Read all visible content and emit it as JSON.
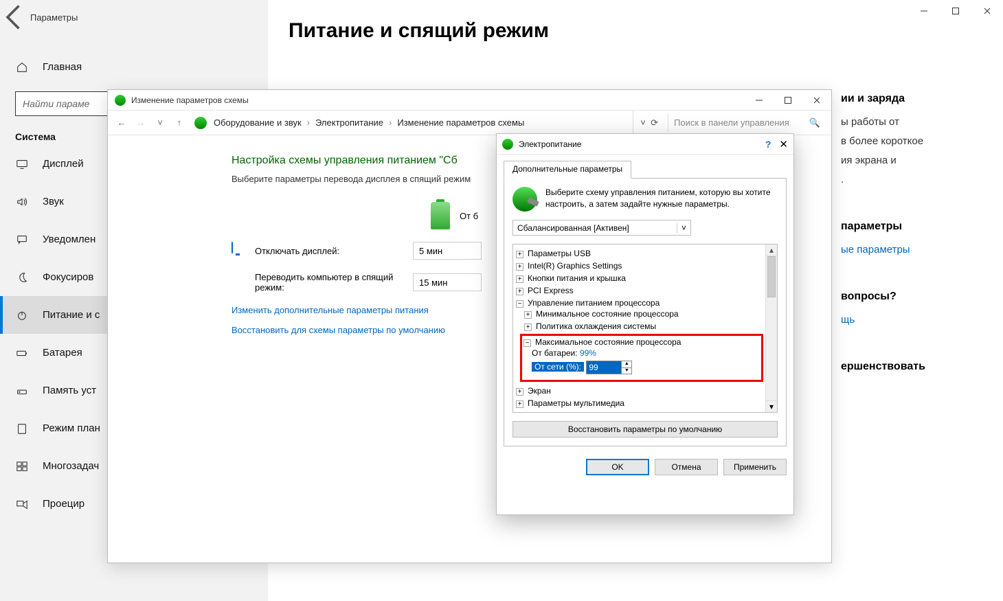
{
  "settings": {
    "title": "Параметры",
    "search_placeholder": "Найти параме",
    "home": "Главная",
    "section": "Система",
    "items": [
      {
        "k": "display",
        "label": "Дисплей"
      },
      {
        "k": "sound",
        "label": "Звук"
      },
      {
        "k": "notif",
        "label": "Уведомлен"
      },
      {
        "k": "focus",
        "label": "Фокусиров"
      },
      {
        "k": "power",
        "label": "Питание и с"
      },
      {
        "k": "battery",
        "label": "Батарея"
      },
      {
        "k": "storage",
        "label": "Память уст"
      },
      {
        "k": "tablet",
        "label": "Режим план"
      },
      {
        "k": "multi",
        "label": "Многозадач"
      },
      {
        "k": "project",
        "label": "Проецир"
      }
    ],
    "page_title": "Питание и спящий режим",
    "info": {
      "h1": "ии и заряда",
      "body": "ы работы от\nв более короткое\nия экрана и\n.",
      "h2": "параметры",
      "link1": "ые параметры",
      "h3": "вопросы?",
      "link2": "щь",
      "h4": "ершенствовать"
    }
  },
  "cpanel": {
    "title": "Изменение параметров схемы",
    "crumbs": [
      "Оборудование и звук",
      "Электропитание",
      "Изменение параметров схемы"
    ],
    "search_placeholder": "Поиск в панели управления",
    "heading": "Настройка схемы управления питанием \"Сб",
    "desc": "Выберите параметры перевода дисплея в спящий режим",
    "on_battery": "От б",
    "row_display": "Отключать дисплей:",
    "row_sleep": "Переводить компьютер в спящий режим:",
    "val_display": "5 мин",
    "val_sleep": "15 мин",
    "link_adv": "Изменить дополнительные параметры питания",
    "link_restore": "Восстановить для схемы параметры по умолчанию"
  },
  "dlg": {
    "title": "Электропитание",
    "tab": "Дополнительные параметры",
    "intro": "Выберите схему управления питанием, которую вы хотите настроить, а затем задайте нужные параметры.",
    "scheme": "Сбалансированная [Активен]",
    "tree": {
      "usb": "Параметры USB",
      "intel": "Intel(R) Graphics Settings",
      "lid": "Кнопки питания и крышка",
      "pci": "PCI Express",
      "cpu": "Управление питанием процессора",
      "cpu_min": "Минимальное состояние процессора",
      "cooling": "Политика охлаждения системы",
      "cpu_max": "Максимальное состояние процессора",
      "battery_label": "От батареи:",
      "battery_val": "99%",
      "plugged_label": "От сети (%):",
      "plugged_val": "99",
      "screen": "Экран",
      "media": "Параметры мультимедиа"
    },
    "restore": "Восстановить параметры по умолчанию",
    "ok": "OK",
    "cancel": "Отмена",
    "apply": "Применить"
  }
}
